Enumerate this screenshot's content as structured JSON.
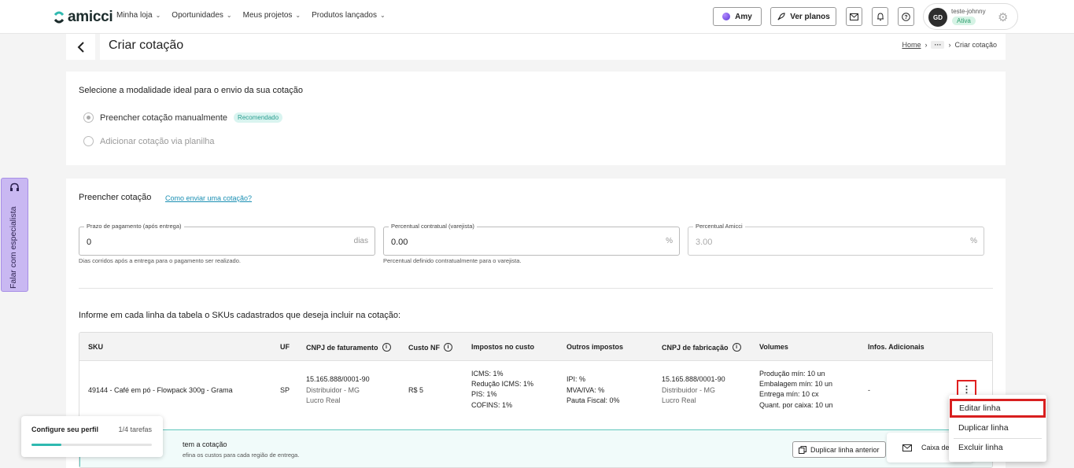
{
  "brand": {
    "name": "amicci",
    "color": "#1b2b2b",
    "accent": "#2fb9b0"
  },
  "nav": [
    {
      "label": "Minha loja"
    },
    {
      "label": "Oportunidades"
    },
    {
      "label": "Meus projetos"
    },
    {
      "label": "Produtos lançados"
    }
  ],
  "topbar": {
    "amy_label": "Amy",
    "plans_label": "Ver planos",
    "icons": [
      "mail-icon",
      "bell-icon",
      "help-icon"
    ]
  },
  "user": {
    "initials": "GD",
    "name": "teste-johnny",
    "status": "Ativa"
  },
  "page": {
    "title": "Criar cotação",
    "breadcrumb": {
      "home": "Home",
      "ellipsis": "···",
      "current": "Criar cotação"
    }
  },
  "modality": {
    "title": "Selecione a modalidade ideal para o envio da sua cotação",
    "options": [
      {
        "label": "Preencher cotação manualmente",
        "badge": "Recomendado",
        "selected": true
      },
      {
        "label": "Adicionar cotação via planilha",
        "selected": false
      }
    ]
  },
  "fill": {
    "title": "Preencher cotação",
    "help_link": "Como enviar uma cotação?",
    "fields": [
      {
        "label": "Prazo de pagamento (após entrega)",
        "value": "0",
        "suffix": "dias",
        "help": "Dias corridos após a entrega para o pagamento ser realizado."
      },
      {
        "label": "Percentual contratual (varejista)",
        "value": "0.00",
        "suffix": "%",
        "help": "Percentual definido contratualmente para o varejista."
      },
      {
        "label": "Percentual Amicci",
        "value": "3.00",
        "suffix": "%",
        "help": ""
      }
    ],
    "table_intro": "Informe em cada linha da tabela o SKUs cadastrados que deseja incluir na cotação:"
  },
  "table": {
    "headers": [
      "SKU",
      "UF",
      "CNPJ de faturamento",
      "Custo NF",
      "Impostos no custo",
      "Outros impostos",
      "CNPJ de fabricação",
      "Volumes",
      "Infos. Adicionais"
    ],
    "row": {
      "sku": "49144 - Café em pó - Flowpack 300g - Grama",
      "uf": "SP",
      "cnpj_fat": [
        "15.165.888/0001-90",
        "Distribuidor - MG",
        "Lucro Real"
      ],
      "custo_nf": "R$ 5",
      "impostos": [
        "ICMS: 1%",
        "Redução ICMS: 1%",
        "PIS: 1%",
        "COFINS: 1%"
      ],
      "outros": [
        "IPI: %",
        "MVA/IVA: %",
        "Pauta Fiscal: 0%"
      ],
      "cnpj_fab": [
        "15.165.888/0001-90",
        "Distribuidor - MG",
        "Lucro Real"
      ],
      "volumes": [
        "Produção mín: 10 un",
        "Embalagem mín: 10 un",
        "Entrega mín: 10 cx",
        "Quant. por caixa: 10 un"
      ],
      "infos": "-",
      "actions_icon": "⋮"
    },
    "add_row": {
      "title": "tem a cotação",
      "subtitle": "efina os custos para cada região de entrega.",
      "duplicate_label": "Duplicar linha anterior",
      "inbox_label": "Caixa de"
    }
  },
  "context_menu": [
    "Editar linha",
    "Duplicar linha",
    "Excluir linha"
  ],
  "side_tab": {
    "label": "Falar com especialista"
  },
  "profile_tasks": {
    "title": "Configure seu perfil",
    "count": "1/4 tarefas",
    "progress": 0.25
  }
}
